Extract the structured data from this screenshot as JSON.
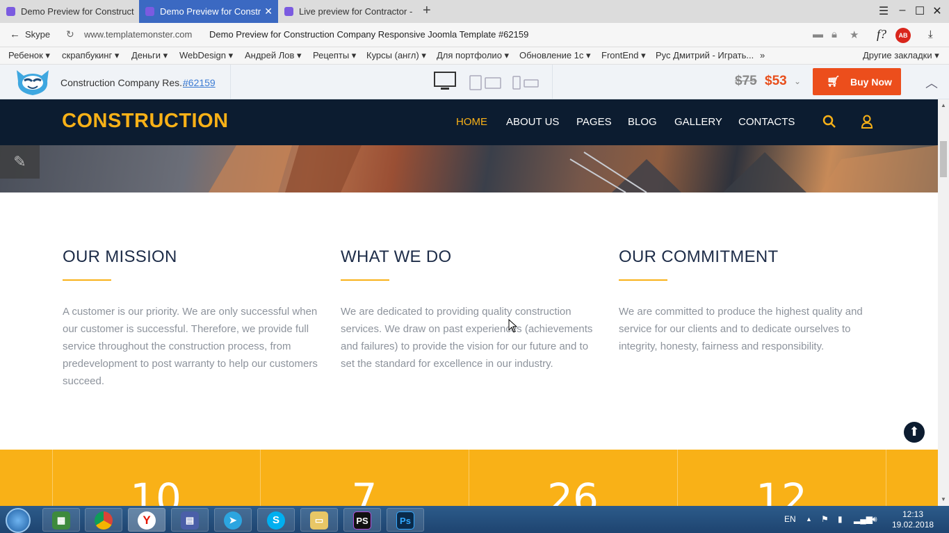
{
  "browser": {
    "tabs": [
      {
        "label": "Demo Preview for Construct",
        "active": false
      },
      {
        "label": "Demo Preview for Constr",
        "active": true
      },
      {
        "label": "Live preview for Contractor -",
        "active": false
      }
    ],
    "new_tab": "+",
    "address": {
      "skype": "Skype",
      "domain": "www.templatemonster.com",
      "page_title": "Demo Preview for Construction Company Responsive Joomla Template #62159"
    },
    "bookmarks": [
      "Ребенок ▾",
      "скрапбукинг ▾",
      "Деньги ▾",
      "WebDesign ▾",
      "Андрей Лов ▾",
      "Рецепты ▾",
      "Курсы (англ) ▾",
      "Для портфолио ▾",
      "Обновление 1с ▾",
      "FrontEnd ▾",
      "Рус Дмитрий - Играть...",
      "»",
      "Другие закладки ▾"
    ]
  },
  "tmbar": {
    "template_name": "Construction Company Res...",
    "template_id": "#62159",
    "old_price": "$75",
    "new_price": "$53",
    "buy_label": "Buy Now"
  },
  "site": {
    "brand": "CONSTRUCTION",
    "nav": [
      "HOME",
      "ABOUT US",
      "PAGES",
      "BLOG",
      "GALLERY",
      "CONTACTS"
    ],
    "columns": [
      {
        "title": "OUR MISSION",
        "text": "A customer is our priority. We are only successful when our customer is successful. Therefore, we provide full service throughout the construction process, from predevelopment to post warranty to help our customers succeed."
      },
      {
        "title": "WHAT WE DO",
        "text": "We are dedicated to providing quality construction services. We draw on past experiences (achievements and failures) to provide the vision for our future and to set the standard for excellence in our industry."
      },
      {
        "title": "OUR COMMITMENT",
        "text": "We are committed to produce the highest quality and service for our clients and to dedicate ourselves to integrity, honesty, fairness and responsibility."
      }
    ],
    "counters": [
      "10",
      "7",
      "26",
      "12"
    ]
  },
  "taskbar": {
    "lang": "EN",
    "time": "12:13",
    "date": "19.02.2018"
  },
  "colors": {
    "accent": "#f9b117",
    "nav_bg": "#0c1c30",
    "buy_button": "#ec4e1c",
    "heading": "#1d2c48",
    "body_text": "#8d939c"
  }
}
